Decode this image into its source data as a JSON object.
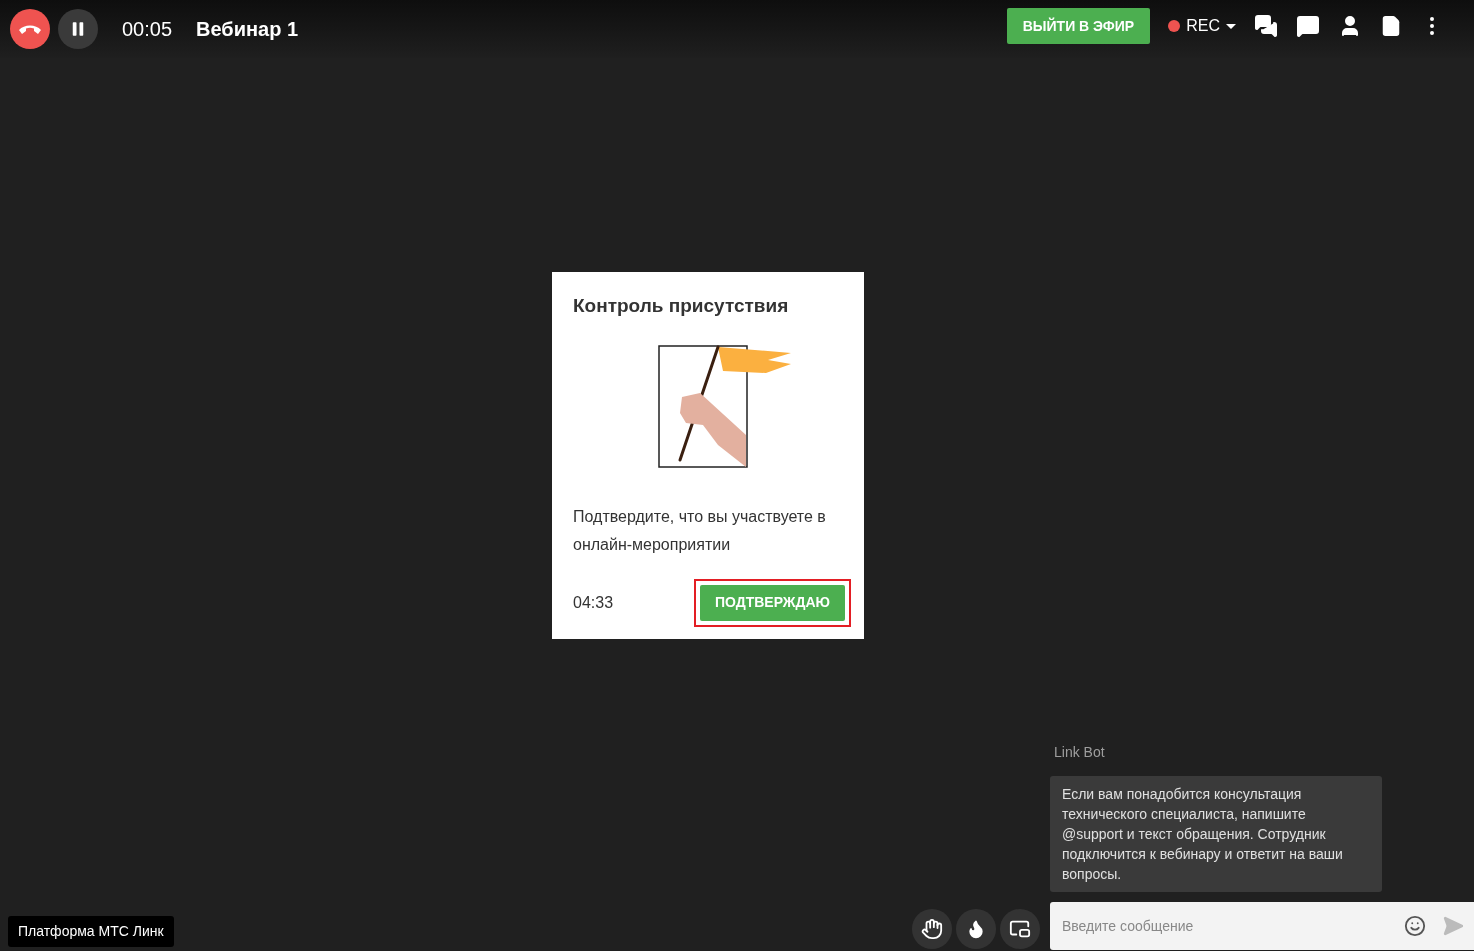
{
  "top_bar": {
    "timer": "00:05",
    "title": "Вебинар 1",
    "go_live_button": "ВЫЙТИ В ЭФИР",
    "rec": {
      "label": "REC",
      "recording": true
    }
  },
  "dialog": {
    "title": "Контроль присутствия",
    "message": "Подтвердите, что вы участвуете в онлайн-мероприятии",
    "countdown": "04:33",
    "confirm_button": {
      "label": "ПОДТВЕРЖДАЮ",
      "highlighted": true
    }
  },
  "chat": {
    "sender": "Link Bot",
    "message": "Если вам понадобится консультация технического специалиста, напишите @support и текст обращения. Сотрудник подключится к вебинару и ответит на ваши вопросы.",
    "input": {
      "placeholder": "Введите сообщение"
    }
  },
  "platform_badge": "Платформа МТС Линк"
}
